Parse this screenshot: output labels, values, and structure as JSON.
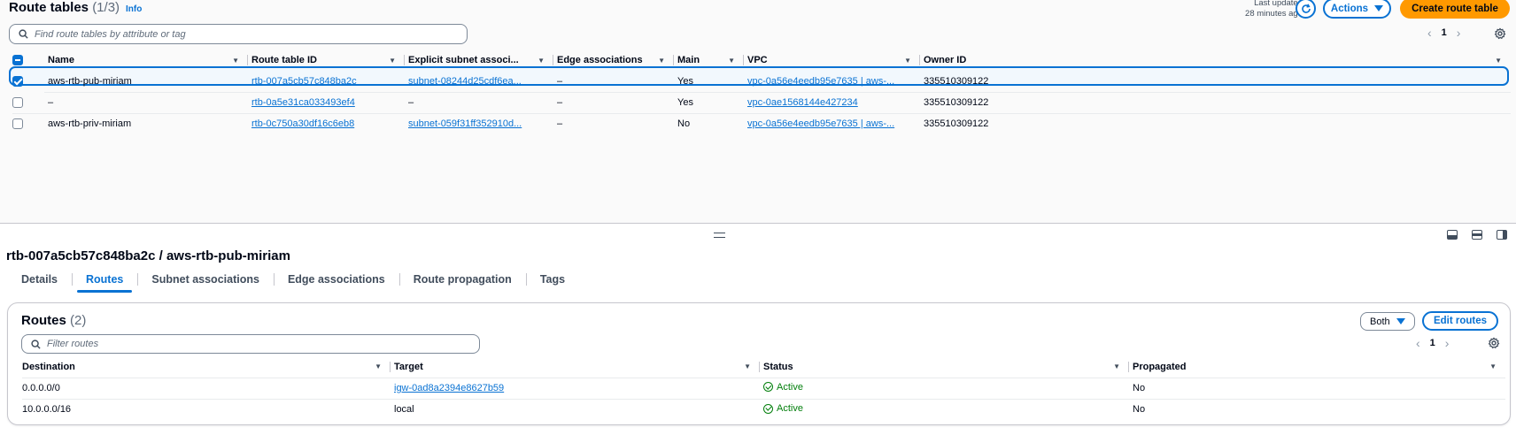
{
  "route_tables": {
    "title": "Route tables",
    "count": "(1/3)",
    "info_label": "Info",
    "last_updated_line1": "Last updated",
    "last_updated_line2": "28 minutes ago",
    "actions_label": "Actions",
    "create_label": "Create route table",
    "search_placeholder": "Find route tables by attribute or tag",
    "page": "1",
    "columns": [
      "Name",
      "Route table ID",
      "Explicit subnet associ...",
      "Edge associations",
      "Main",
      "VPC",
      "Owner ID"
    ],
    "rows": [
      {
        "selected": true,
        "name": "aws-rtb-pub-miriam",
        "id": "rtb-007a5cb57c848ba2c",
        "subnet": "subnet-08244d25cdf6ea...",
        "subnet_is_link": true,
        "edge": "–",
        "main": "Yes",
        "vpc": "vpc-0a56e4eedb95e7635 | aws-...",
        "owner": "335510309122"
      },
      {
        "selected": false,
        "name": "–",
        "id": "rtb-0a5e31ca033493ef4",
        "subnet": "–",
        "subnet_is_link": false,
        "edge": "–",
        "main": "Yes",
        "vpc": "vpc-0ae1568144e427234",
        "owner": "335510309122"
      },
      {
        "selected": false,
        "name": "aws-rtb-priv-miriam",
        "id": "rtb-0c750a30df16c6eb8",
        "subnet": "subnet-059f31ff352910d...",
        "subnet_is_link": true,
        "edge": "–",
        "main": "No",
        "vpc": "vpc-0a56e4eedb95e7635 | aws-...",
        "owner": "335510309122"
      }
    ]
  },
  "detail": {
    "title": "rtb-007a5cb57c848ba2c / aws-rtb-pub-miriam",
    "tabs": [
      "Details",
      "Routes",
      "Subnet associations",
      "Edge associations",
      "Route propagation",
      "Tags"
    ],
    "active_tab": "Routes"
  },
  "routes": {
    "title": "Routes",
    "count": "(2)",
    "filter_label": "Both",
    "edit_label": "Edit routes",
    "search_placeholder": "Filter routes",
    "page": "1",
    "columns": [
      "Destination",
      "Target",
      "Status",
      "Propagated"
    ],
    "rows": [
      {
        "destination": "0.0.0.0/0",
        "target": "igw-0ad8a2394e8627b59",
        "target_is_link": true,
        "status": "Active",
        "propagated": "No"
      },
      {
        "destination": "10.0.0.0/16",
        "target": "local",
        "target_is_link": false,
        "status": "Active",
        "propagated": "No"
      }
    ]
  },
  "colors": {
    "link": "#0972d3",
    "primary_button": "#ff9900",
    "success": "#037f0c",
    "selected_row_bg": "#f2f8fd"
  },
  "icons": [
    "search-icon",
    "refresh-icon",
    "caret-down-icon",
    "settings-gear-icon",
    "chevron-left-icon",
    "chevron-right-icon",
    "sort-caret-icon",
    "status-success-icon",
    "panel-layout-icon",
    "resize-grip-icon"
  ]
}
